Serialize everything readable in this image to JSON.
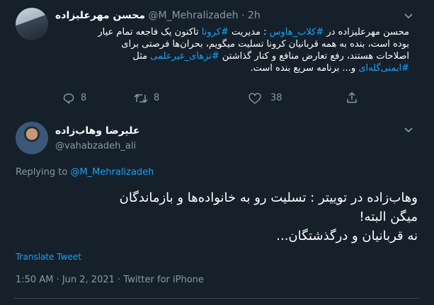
{
  "tweet1": {
    "display_name": "محسن مهرعلیزاده",
    "handle": "@M_Mehralizadeh",
    "separator": "·",
    "time": "2h",
    "lines": [
      {
        "parts": [
          {
            "t": "محسن مهرعلیزاده در ",
            "link": false
          },
          {
            "t": "#کلاب_هاوس",
            "link": true
          },
          {
            "t": " : مدیریت ",
            "link": false
          },
          {
            "t": "#کرونا",
            "link": true
          },
          {
            "t": " تاکنون یک فاجعه تمام عیار",
            "link": false
          }
        ]
      },
      {
        "parts": [
          {
            "t": "بوده است، بنده به همه قربانیان کرونا تسلیت میگویم، بحران‌ها فرصتی برای",
            "link": false
          }
        ]
      },
      {
        "parts": [
          {
            "t": "اصلاحات هستند، رفع تعارض منافع و کنار گذاشتن ",
            "link": false
          },
          {
            "t": "#تزهای_غیرعلمی",
            "link": true
          },
          {
            "t": " مثل",
            "link": false
          }
        ]
      },
      {
        "parts": [
          {
            "t": "#ایمنی‌گله‌ای",
            "link": true
          },
          {
            "t": " و... برنامه سریع بنده است.",
            "link": false
          }
        ]
      }
    ],
    "reply_count": "8",
    "retweet_count": "8",
    "like_count": "38"
  },
  "tweet2": {
    "display_name": "علیرضا وهاب‌زاده",
    "handle": "@vahabzadeh_ali",
    "replying_prefix": "Replying to ",
    "replying_to": "@M_Mehralizadeh",
    "lines": [
      "وهاب‌زاده در توییتر : تسلیت رو به خانواده‌ها و بازماندگان",
      "میگن البته!",
      "نه قربانیان و درگذشتگان..."
    ],
    "translate_label": "Translate Tweet",
    "timestamp": "1:50 AM · Jun 2, 2021 · Twitter for iPhone"
  },
  "colors": {
    "background": "#15202b",
    "text": "#ffffff",
    "muted": "#8899a6",
    "link": "#1da1f2",
    "divider": "#38444d"
  },
  "icons": [
    "chevron-down-icon",
    "reply-icon",
    "retweet-icon",
    "like-icon",
    "share-icon"
  ]
}
